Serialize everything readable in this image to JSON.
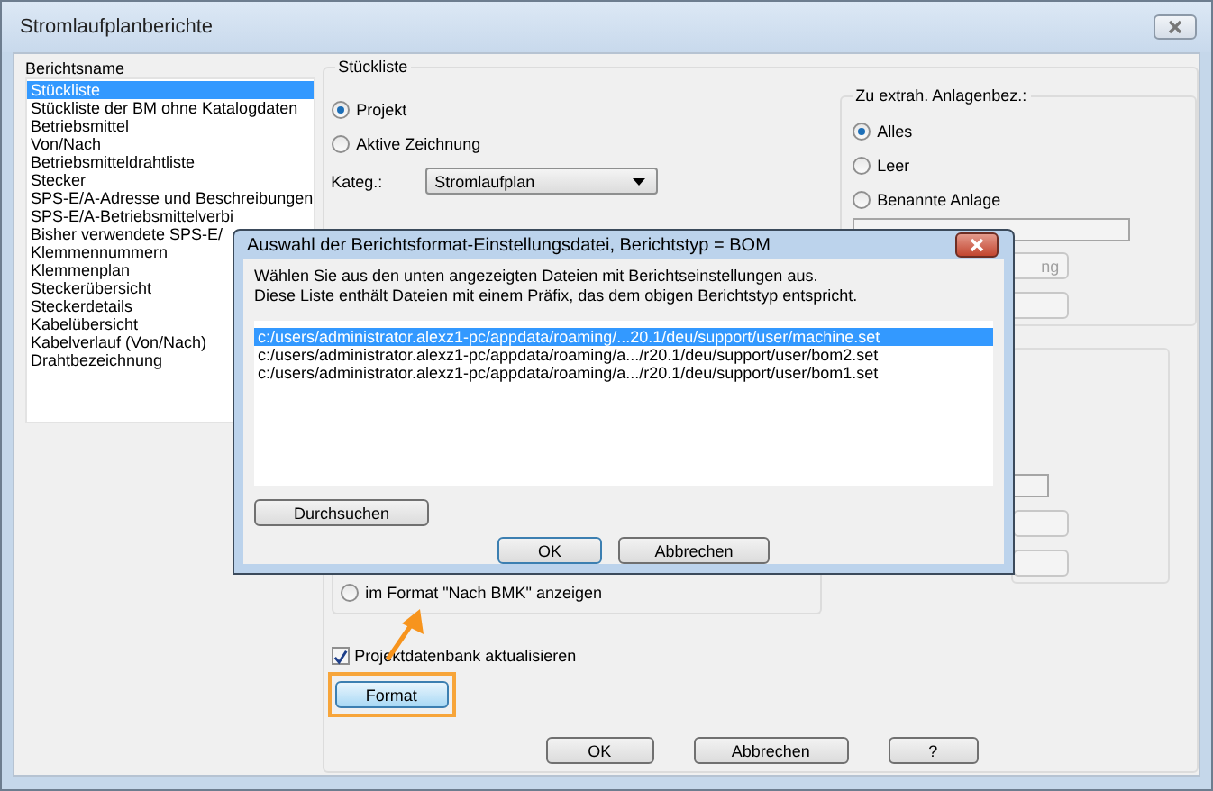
{
  "window": {
    "title": "Stromlaufplanberichte"
  },
  "report_list": {
    "label": "Berichtsname",
    "items": [
      {
        "text": "Stückliste",
        "selected": true
      },
      {
        "text": "Stückliste der BM ohne Katalogdaten",
        "selected": false
      },
      {
        "text": "Betriebsmittel",
        "selected": false
      },
      {
        "text": "Von/Nach",
        "selected": false
      },
      {
        "text": "Betriebsmitteldrahtliste",
        "selected": false
      },
      {
        "text": "Stecker",
        "selected": false
      },
      {
        "text": "SPS-E/A-Adresse und Beschreibungen",
        "selected": false
      },
      {
        "text": "SPS-E/A-Betriebsmittelverbi",
        "selected": false
      },
      {
        "text": "Bisher verwendete SPS-E/",
        "selected": false
      },
      {
        "text": "Klemmennummern",
        "selected": false
      },
      {
        "text": "Klemmenplan",
        "selected": false
      },
      {
        "text": "Steckerübersicht",
        "selected": false
      },
      {
        "text": "Steckerdetails",
        "selected": false
      },
      {
        "text": "Kabelübersicht",
        "selected": false
      },
      {
        "text": "Kabelverlauf (Von/Nach)",
        "selected": false
      },
      {
        "text": "Drahtbezeichnung",
        "selected": false
      }
    ]
  },
  "bom_group": {
    "title": "Stückliste",
    "scope": [
      {
        "label": "Projekt",
        "selected": true
      },
      {
        "label": "Aktive Zeichnung",
        "selected": false
      }
    ],
    "category_label": "Kateg.:",
    "category_value": "Stromlaufplan"
  },
  "extract_group": {
    "title": "Zu extrah. Anlagenbez.:",
    "options": [
      {
        "label": "Alles",
        "selected": true
      },
      {
        "label": "Leer",
        "selected": false
      },
      {
        "label": "Benannte Anlage",
        "selected": false
      }
    ],
    "button_label": "ng"
  },
  "format_option": {
    "label": "im Format \"Nach BMK\" anzeigen",
    "selected": false
  },
  "update_db": {
    "label": "Projektdatenbank aktualisieren",
    "checked": true
  },
  "format_button": "Format",
  "buttons": [
    "OK",
    "Abbrechen",
    "?"
  ],
  "dialog": {
    "title": "Auswahl der Berichtsformat-Einstellungsdatei, Berichtstyp = BOM",
    "message": [
      "Wählen Sie aus den unten angezeigten Dateien mit Berichtseinstellungen aus.",
      "Diese Liste enthält Dateien mit einem Präfix, das dem obigen Berichtstyp entspricht."
    ],
    "files": [
      {
        "path": "c:/users/administrator.alexz1-pc/appdata/roaming/...20.1/deu/support/user/machine.set",
        "selected": true
      },
      {
        "path": "c:/users/administrator.alexz1-pc/appdata/roaming/a.../r20.1/deu/support/user/bom2.set",
        "selected": false
      },
      {
        "path": "c:/users/administrator.alexz1-pc/appdata/roaming/a.../r20.1/deu/support/user/bom1.set",
        "selected": false
      }
    ],
    "browse_button": "Durchsuchen",
    "buttons": [
      "OK",
      "Abbrechen"
    ]
  }
}
